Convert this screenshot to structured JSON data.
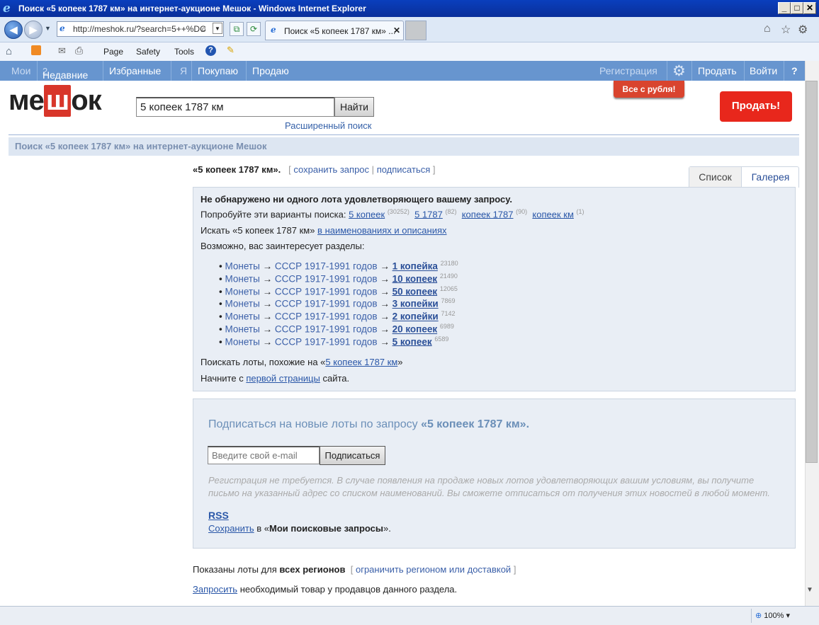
{
  "window": {
    "title": "Поиск «5 копеек 1787 км» на интернет-аукционе Мешок - Windows Internet Explorer",
    "min": "_",
    "max": "□",
    "close": "✕"
  },
  "browser": {
    "url": "http://meshok.ru/?search=5++%DC",
    "tab_title": "Поиск «5 копеек 1787 км» ...",
    "tab_close": "✕",
    "cmd": {
      "page": "Page",
      "safety": "Safety",
      "tools": "Tools"
    },
    "zoom": "100%"
  },
  "nav": {
    "moi": "Мои",
    "recent": "Недавние",
    "recent_count": "2",
    "favorites": "Избранные",
    "ya": "Я",
    "buying": "Покупаю",
    "selling": "Продаю",
    "register": "Регистрация",
    "sell": "Продать",
    "login": "Войти",
    "help": "?"
  },
  "header": {
    "logo_left": "ме",
    "logo_mid": "ш",
    "logo_right": "ок",
    "search_value": "5  копеек 1787 км",
    "find_button": "Найти",
    "advanced": "Расширенный поиск",
    "all_ruble": "Все с рубля!",
    "sell_button": "Продать!"
  },
  "breadcrumb": "Поиск «5 копеек 1787 км» на интернет-аукционе Мешок",
  "query": {
    "label": "«5 копеек 1787 км».",
    "bracket_open": "[",
    "save": "сохранить запрос",
    "pipe": "|",
    "subscribe": "подписаться",
    "bracket_close": "]"
  },
  "view": {
    "list": "Список",
    "gallery": "Галерея"
  },
  "results": {
    "none": "Не обнаружено ни одного лота удовлетворяющего вашему запросу.",
    "try": "Попробуйте эти варианты поиска:",
    "variants": [
      {
        "text": "5 копеек",
        "count": "(30252)"
      },
      {
        "text": "5 1787",
        "count": "(82)"
      },
      {
        "text": "копеек 1787",
        "count": "(90)"
      },
      {
        "text": "копеек км",
        "count": "(1)"
      }
    ],
    "search_in_prefix": "Искать «5 копеек 1787 км»",
    "search_in_link": "в наименованиях и описаниях",
    "maybe": "Возможно, вас заинтересует разделы:",
    "cat1": "Монеты",
    "arrow": "→",
    "cat2": "СССР 1917-1991 годов",
    "sections": [
      {
        "name": "1 копейка",
        "count": "23180"
      },
      {
        "name": "10 копеек",
        "count": "21490"
      },
      {
        "name": "50 копеек",
        "count": "12065"
      },
      {
        "name": "3 копейки",
        "count": "7869"
      },
      {
        "name": "2 копейки",
        "count": "7142"
      },
      {
        "name": "20 копеек",
        "count": "6989"
      },
      {
        "name": "5 копеек",
        "count": "6589"
      }
    ],
    "similar_prefix": "Поискать лоты, похожие на «",
    "similar_link": "5 копеек 1787 км",
    "similar_suffix": "»",
    "start_prefix": "Начните с",
    "start_link": "первой страницы",
    "start_suffix": "сайта."
  },
  "subscribe": {
    "title_prefix": "Подписаться на новые лоты по запросу",
    "title_query": "«5 копеек 1787 км».",
    "email_placeholder": "Введите свой e-mail",
    "button": "Подписаться",
    "note1": "Регистрация не требуется. В случае появления на продаже новых лотов удовлетворяющих вашим условиям, вы получите",
    "note2": "письмо на указанный адрес со списком наименований. Вы сможете отписаться от получения этих новостей в любой момент.",
    "rss": "RSS",
    "save_link": "Сохранить",
    "save_mid": "в «",
    "save_bold": "Мои поисковые запросы",
    "save_end": "»."
  },
  "footer": {
    "regions_prefix": "Показаны лоты для",
    "regions_bold": "всех регионов",
    "regions_link": "ограничить регионом или доставкой",
    "request_link": "Запросить",
    "request_text": "необходимый товар у продавцов данного раздела."
  }
}
